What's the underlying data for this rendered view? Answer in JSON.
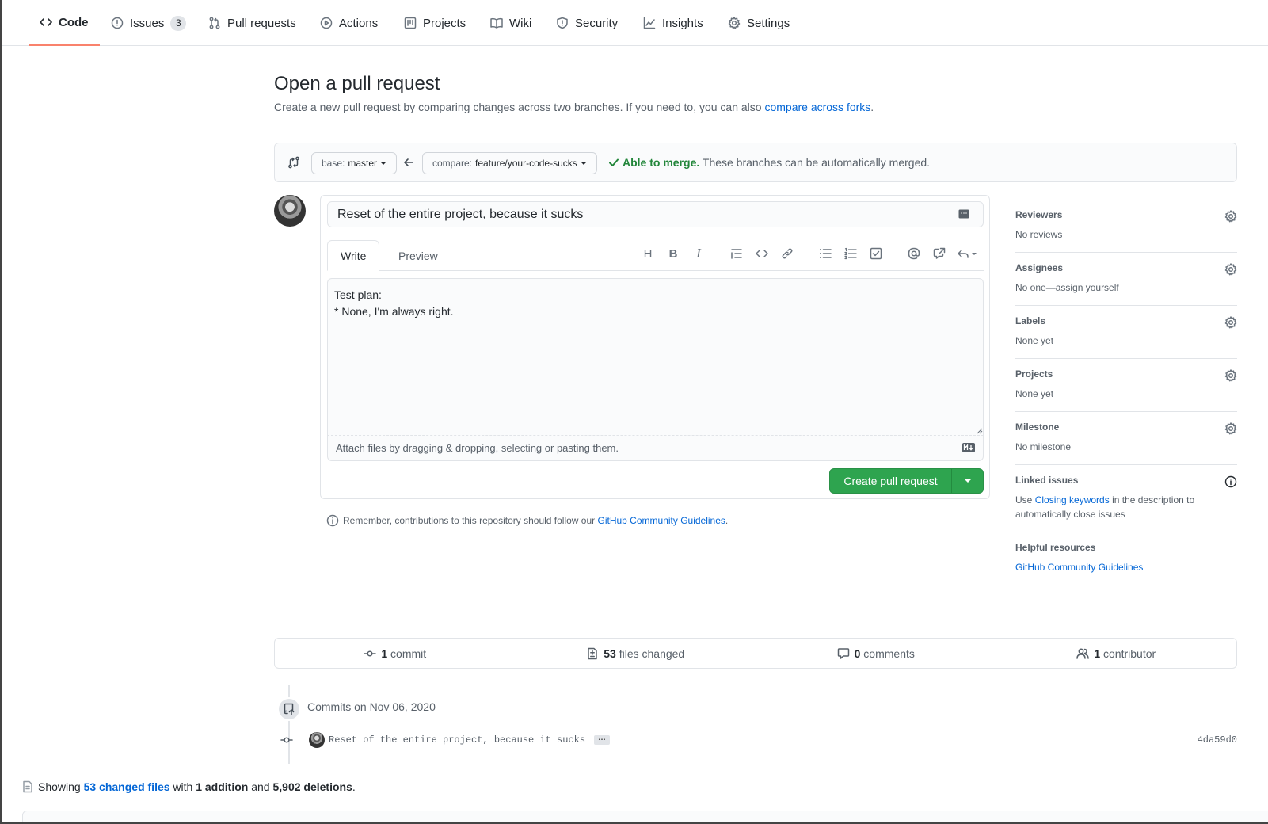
{
  "nav": {
    "tabs": [
      {
        "label": "Code",
        "icon": "code-icon",
        "selected": true
      },
      {
        "label": "Issues",
        "icon": "issue-opened-icon",
        "count": "3"
      },
      {
        "label": "Pull requests",
        "icon": "git-pull-request-icon"
      },
      {
        "label": "Actions",
        "icon": "play-icon"
      },
      {
        "label": "Projects",
        "icon": "project-icon"
      },
      {
        "label": "Wiki",
        "icon": "book-icon"
      },
      {
        "label": "Security",
        "icon": "shield-icon"
      },
      {
        "label": "Insights",
        "icon": "graph-icon"
      },
      {
        "label": "Settings",
        "icon": "gear-icon"
      }
    ]
  },
  "header": {
    "title": "Open a pull request",
    "subtitle": "Create a new pull request by comparing changes across two branches. If you need to, you can also ",
    "subtitle_link": "compare across forks",
    "subtitle_end": "."
  },
  "range": {
    "base_prefix": "base:",
    "base_branch": "master",
    "compare_prefix": "compare:",
    "compare_branch": "feature/your-code-sucks",
    "merge_status": "Able to merge.",
    "merge_detail": " These branches can be automatically merged."
  },
  "composer": {
    "title_value": "Reset of the entire project, because it sucks",
    "tab_write": "Write",
    "tab_preview": "Preview",
    "toolbar_heading": "H",
    "toolbar_bold": "B",
    "toolbar_italic": "I",
    "body_value": "Test plan:\n* None, I'm always right.",
    "attach_text": "Attach files by dragging & dropping, selecting or pasting them.",
    "submit_label": "Create pull request"
  },
  "remember": {
    "text": "Remember, contributions to this repository should follow our ",
    "link": "GitHub Community Guidelines",
    "end": "."
  },
  "sidebar": {
    "reviewers": {
      "label": "Reviewers",
      "value": "No reviews"
    },
    "assignees": {
      "label": "Assignees",
      "value": "No one—assign yourself"
    },
    "labels": {
      "label": "Labels",
      "value": "None yet"
    },
    "projects": {
      "label": "Projects",
      "value": "None yet"
    },
    "milestone": {
      "label": "Milestone",
      "value": "No milestone"
    },
    "linked": {
      "label": "Linked issues",
      "pre": "Use ",
      "link": "Closing keywords",
      "post": " in the description to automatically close issues"
    },
    "helpful": {
      "label": "Helpful resources",
      "link": "GitHub Community Guidelines"
    }
  },
  "numbers": {
    "commits_count": "1",
    "commits_label": "commit",
    "files_count": "53",
    "files_label": "files changed",
    "comments_count": "0",
    "comments_label": "comments",
    "contributors_count": "1",
    "contributors_label": "contributor"
  },
  "commits": {
    "date_heading": "Commits on Nov 06, 2020",
    "message": "Reset of the entire project, because it sucks",
    "ellipsis": "…",
    "sha": "4da59d0"
  },
  "summary": {
    "showing": "Showing",
    "changed_files": "53 changed files",
    "with": "with",
    "additions": "1 addition",
    "and": "and",
    "deletions": "5,902 deletions",
    "end": "."
  },
  "colors": {
    "accent": "#0366d6",
    "success": "#22863a",
    "button_green": "#2ea44f",
    "tab_underline": "#f9826c"
  }
}
